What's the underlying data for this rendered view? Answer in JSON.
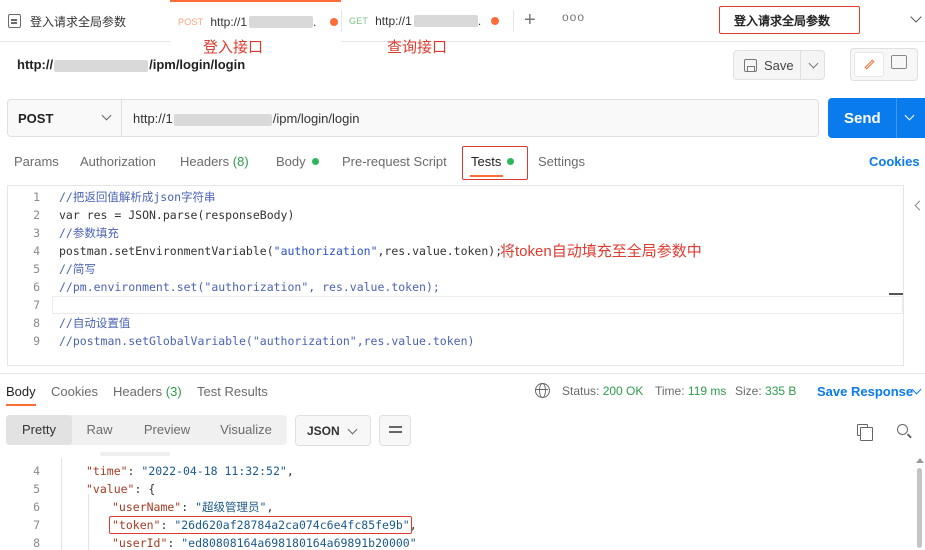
{
  "tabs": {
    "first": {
      "label": "登入请求全局参数"
    },
    "login": {
      "method": "POST",
      "url": "http://1"
    },
    "query": {
      "method": "GET",
      "url": "http://1"
    },
    "new_tab": "+",
    "more": "ooo"
  },
  "environment": {
    "selected": "登入请求全局参数"
  },
  "annotations": {
    "login_api": "登入接口",
    "query_api": "查询接口",
    "token_note": "将token自动填充至全局参数中"
  },
  "request": {
    "title_prefix": "http://",
    "title_suffix": "/ipm/login/login",
    "save_label": "Save",
    "method": "POST",
    "url_prefix": "http://1",
    "url_suffix": "/ipm/login/login",
    "send_label": "Send"
  },
  "request_tabs": {
    "params": "Params",
    "authorization": "Authorization",
    "headers": "Headers",
    "headers_count": "(8)",
    "body": "Body",
    "prerequest": "Pre-request Script",
    "tests": "Tests",
    "settings": "Settings",
    "cookies": "Cookies"
  },
  "script_lines": [
    {
      "n": "1",
      "text": "//把返回值解析成json字符串",
      "kind": "comment"
    },
    {
      "n": "2",
      "text": "var res = JSON.parse(responseBody)",
      "kind": "code"
    },
    {
      "n": "3",
      "text": "//参数填充",
      "kind": "comment"
    },
    {
      "n": "4",
      "text": "postman.setEnvironmentVariable(\"authorization\",res.value.token);",
      "kind": "code"
    },
    {
      "n": "5",
      "text": "//简写",
      "kind": "comment"
    },
    {
      "n": "6",
      "text": "//pm.environment.set(\"authorization\", res.value.token);",
      "kind": "comment"
    },
    {
      "n": "7",
      "text": "",
      "kind": "code"
    },
    {
      "n": "8",
      "text": "//自动设置值",
      "kind": "comment"
    },
    {
      "n": "9",
      "text": "//postman.setGlobalVariable(\"authorization\",res.value.token)",
      "kind": "comment"
    }
  ],
  "response": {
    "tabs": {
      "body": "Body",
      "cookies": "Cookies",
      "headers": "Headers",
      "headers_count": "(3)",
      "test_results": "Test Results"
    },
    "status_label": "Status:",
    "status_value": "200 OK",
    "time_label": "Time:",
    "time_value": "119 ms",
    "size_label": "Size:",
    "size_value": "335 B",
    "save_response": "Save Response",
    "views": [
      "Pretty",
      "Raw",
      "Preview",
      "Visualize"
    ],
    "format": "JSON"
  },
  "json_lines": [
    {
      "n": "4",
      "key": "\"time\"",
      "sep": ": ",
      "val": "\"2022-04-18 11:32:52\"",
      "end": ","
    },
    {
      "n": "5",
      "key": "\"value\"",
      "sep": ": ",
      "val": "",
      "end": "{"
    },
    {
      "n": "6",
      "key": "\"userName\"",
      "sep": ": ",
      "val": "\"超级管理员\"",
      "end": ","
    },
    {
      "n": "7",
      "key": "\"token\"",
      "sep": ": ",
      "val": "\"26d620af28784a2ca074c6e4fc85fe9b\"",
      "end": ","
    },
    {
      "n": "8",
      "key": "\"userId\"",
      "sep": ": ",
      "val": "\"ed80808164a698180164a69891b20000\"",
      "end": ""
    }
  ],
  "colors": {
    "accent": "#ff6c37",
    "send": "#097bed",
    "annotation": "#e03a2f",
    "status_ok": "#2f9c4a"
  }
}
